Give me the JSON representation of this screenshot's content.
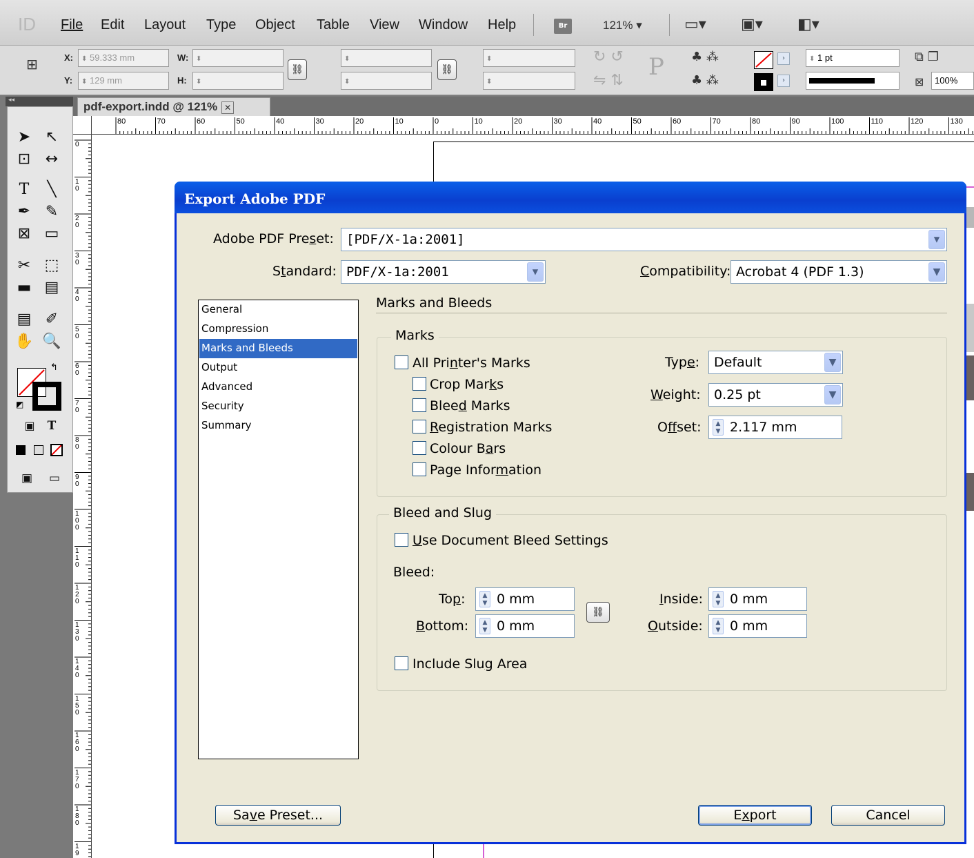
{
  "app": {
    "logo": "ID",
    "menus": [
      "File",
      "Edit",
      "Layout",
      "Type",
      "Object",
      "Table",
      "View",
      "Window",
      "Help"
    ],
    "bridge_label": "Br",
    "zoom": "121%"
  },
  "control_panel": {
    "x_label": "X:",
    "x_value": "59.333 mm",
    "y_label": "Y:",
    "y_value": "129 mm",
    "w_label": "W:",
    "h_label": "H:",
    "stroke_weight": "1 pt",
    "opacity": "100%"
  },
  "document_tab": {
    "title": "pdf-export.indd @ 121%",
    "close": "✕"
  },
  "ruler": {
    "horizontal": [
      "80",
      "70",
      "60",
      "50",
      "40",
      "30",
      "20",
      "10",
      "0",
      "10",
      "20",
      "30",
      "40",
      "50",
      "60",
      "70",
      "80",
      "90",
      "100",
      "110",
      "120",
      "130"
    ],
    "vertical": [
      "0",
      "10",
      "20",
      "30",
      "40",
      "50",
      "60",
      "70",
      "80",
      "90",
      "100",
      "110",
      "120",
      "130",
      "140",
      "150",
      "160",
      "170",
      "180",
      "19"
    ]
  },
  "dialog": {
    "title": "Export Adobe PDF",
    "preset_label": "Adobe PDF Preset:",
    "preset_value": "[PDF/X-1a:2001]",
    "standard_label": "Standard:",
    "standard_value": "PDF/X-1a:2001",
    "compat_label": "Compatibility:",
    "compat_value": "Acrobat 4 (PDF 1.3)",
    "nav": [
      "General",
      "Compression",
      "Marks and Bleeds",
      "Output",
      "Advanced",
      "Security",
      "Summary"
    ],
    "selected_nav": "Marks and Bleeds",
    "section_title": "Marks and Bleeds",
    "marks_group": "Marks",
    "marks": {
      "all": "All Printer's Marks",
      "crop": "Crop Marks",
      "bleed": "Bleed Marks",
      "registration": "Registration Marks",
      "colour_bars": "Colour Bars",
      "page_info": "Page Information"
    },
    "type_label": "Type:",
    "type_value": "Default",
    "weight_label": "Weight:",
    "weight_value": "0.25 pt",
    "offset_label": "Offset:",
    "offset_value": "2.117 mm",
    "bleed_group": "Bleed and Slug",
    "use_doc_bleed": "Use Document Bleed Settings",
    "bleed_label": "Bleed:",
    "top_label": "Top:",
    "top_value": "0 mm",
    "bottom_label": "Bottom:",
    "bottom_value": "0 mm",
    "inside_label": "Inside:",
    "inside_value": "0 mm",
    "outside_label": "Outside:",
    "outside_value": "0 mm",
    "include_slug": "Include Slug Area",
    "save_preset": "Save Preset...",
    "export": "Export",
    "cancel": "Cancel"
  }
}
